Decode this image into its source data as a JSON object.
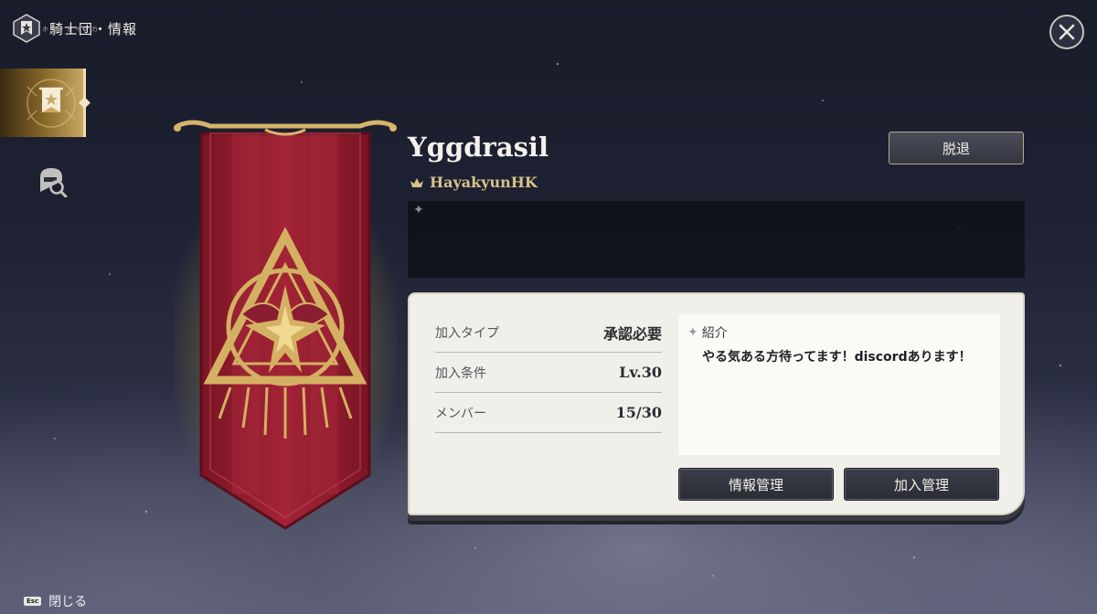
{
  "header": {
    "title": "騎士団・情報",
    "subtitle": "ホウ｜まイナカ",
    "emblem_icon": "guild-emblem-icon"
  },
  "close_icon": "close-icon",
  "side_nav": {
    "items": [
      {
        "name": "guild-info",
        "icon": "banner-icon",
        "active": true
      },
      {
        "name": "guild-search",
        "icon": "helmet-search-icon",
        "active": false
      }
    ]
  },
  "guild": {
    "name": "Yggdrasil",
    "leader": "HayakyunHK",
    "leader_icon": "leader-crown-icon",
    "leave_label": "脱退",
    "banner_color": "#8e1a2c",
    "accent_color": "#d4b063"
  },
  "details": {
    "rows": [
      {
        "label": "加入タイプ",
        "value": "承認必要"
      },
      {
        "label": "加入条件",
        "value": "Lv.30"
      },
      {
        "label": "メンバー",
        "value": "15/30"
      }
    ],
    "intro_title": "紹介",
    "intro_text": "やる気ある方待ってます！discordあります！",
    "info_manage_label": "情報管理",
    "join_manage_label": "加入管理"
  },
  "footer": {
    "key": "Esc",
    "label": "閉じる"
  }
}
